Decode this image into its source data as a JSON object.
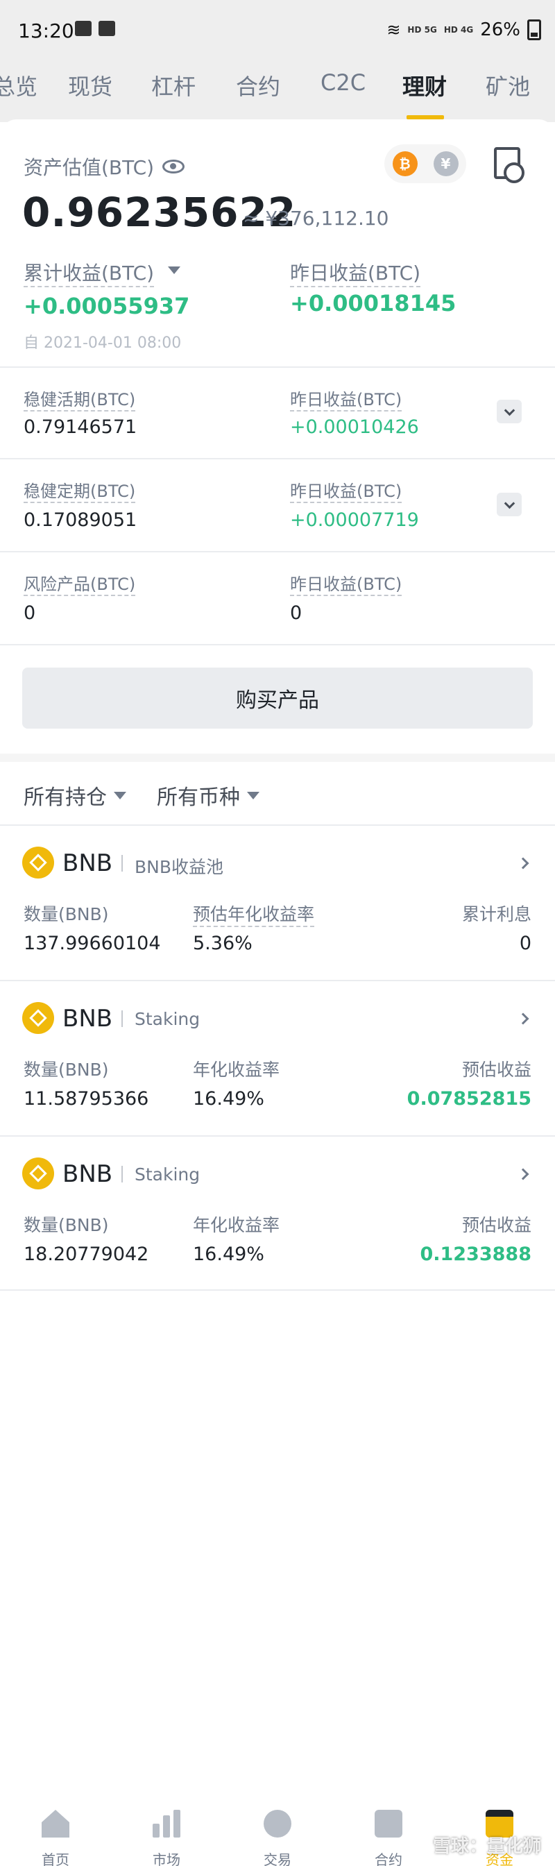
{
  "status_bar": {
    "time": "13:20",
    "network": "HD 5G",
    "network2": "HD 4G",
    "battery": "26%"
  },
  "top_tabs": [
    {
      "label": "总览",
      "active": false
    },
    {
      "label": "现货",
      "active": false
    },
    {
      "label": "杠杆",
      "active": false
    },
    {
      "label": "合约",
      "active": false
    },
    {
      "label": "C2C",
      "active": false
    },
    {
      "label": "理财",
      "active": true
    },
    {
      "label": "矿池",
      "active": false
    }
  ],
  "summary": {
    "asset_label": "资产估值(BTC)",
    "asset_value": "0.96235622",
    "asset_cny": "≈ ¥376,112.10",
    "coin_btc": "₿",
    "coin_cny": "¥",
    "cumulative_label": "累计收益(BTC)",
    "cumulative_value": "+0.00055937",
    "cumulative_since": "自 2021-04-01 08:00",
    "yesterday_label": "昨日收益(BTC)",
    "yesterday_value": "+0.00018145"
  },
  "rows": [
    {
      "label": "稳健活期(BTC)",
      "value": "0.79146571",
      "y_label": "昨日收益(BTC)",
      "y_value": "+0.00010426",
      "y_green": true
    },
    {
      "label": "稳健定期(BTC)",
      "value": "0.17089051",
      "y_label": "昨日收益(BTC)",
      "y_value": "+0.00007719",
      "y_green": true
    },
    {
      "label": "风险产品(BTC)",
      "value": "0",
      "y_label": "昨日收益(BTC)",
      "y_value": "0",
      "y_green": false
    }
  ],
  "buy_button": "购买产品",
  "filters": {
    "positions": "所有持仓",
    "currencies": "所有币种"
  },
  "products": [
    {
      "coin": "BNB",
      "type": "BNB收益池",
      "col1_label": "数量(BNB)",
      "col1_value": "137.99660104",
      "col2_label": "预估年化收益率",
      "col2_value": "5.36%",
      "col3_label": "累计利息",
      "col3_value": "0"
    },
    {
      "coin": "BNB",
      "type": "Staking",
      "col1_label": "数量(BNB)",
      "col1_value": "11.58795366",
      "col2_label": "年化收益率",
      "col2_value": "16.49%",
      "col3_label": "预估收益",
      "col3_value": "0.07852815"
    },
    {
      "coin": "BNB",
      "type": "Staking",
      "col1_label": "数量(BNB)",
      "col1_value": "18.20779042",
      "col2_label": "年化收益率",
      "col2_value": "16.49%",
      "col3_label": "预估收益",
      "col3_value": "0.1233888"
    }
  ],
  "bottom_nav": [
    {
      "label": "首页",
      "icon": "home-icon",
      "active": false
    },
    {
      "label": "市场",
      "icon": "market-icon",
      "active": false
    },
    {
      "label": "交易",
      "icon": "trade-icon",
      "active": false
    },
    {
      "label": "合约",
      "icon": "futures-icon",
      "active": false
    },
    {
      "label": "资金",
      "icon": "wallet-icon",
      "active": true
    }
  ],
  "watermark": "雪球：量化狮",
  "colors": {
    "accent": "#f0b90b",
    "positive": "#2ebd85",
    "muted": "#707a8a"
  }
}
